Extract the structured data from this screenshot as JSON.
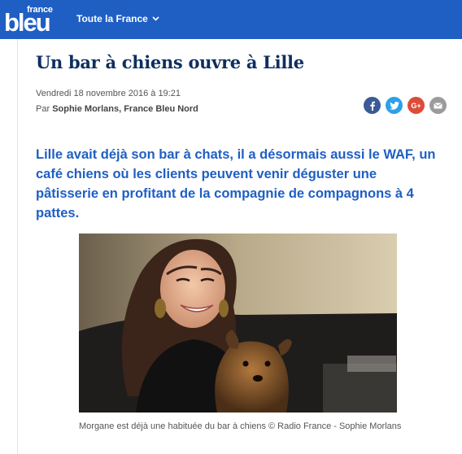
{
  "header": {
    "logo_small": "france",
    "logo_big": "bleu",
    "nav_label": "Toute la France",
    "brand_color": "#1f5fc4"
  },
  "article": {
    "title": "Un bar à chiens ouvre à Lille",
    "date": "Vendredi 18 novembre 2016 à 19:21",
    "byline_prefix": "Par",
    "byline_author": "Sophie Morlans, France Bleu Nord",
    "lead": "Lille avait déjà son bar à chats, il a désormais aussi le WAF, un café chiens où les clients peuvent venir déguster une pâtisserie en profitant de la compagnie de compagnons à 4 pattes.",
    "caption": "Morgane est déjà une habituée du bar à chiens © Radio France - Sophie Morlans"
  },
  "share": {
    "facebook_icon": "facebook-icon",
    "twitter_icon": "twitter-icon",
    "googleplus_icon": "google-plus-icon",
    "googleplus_label": "G+",
    "mail_icon": "mail-icon"
  }
}
